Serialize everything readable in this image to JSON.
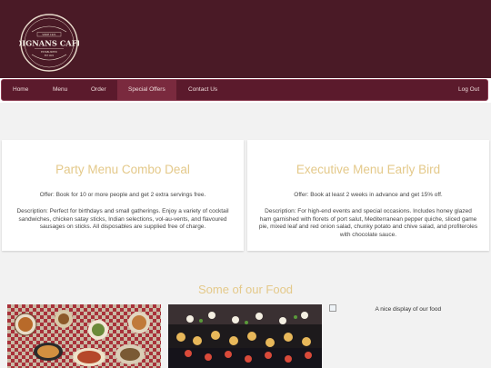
{
  "brand": {
    "name": "DIGNANS CAFE",
    "since": "SINCE 1921",
    "est": "EST 1921",
    "established": "ESTABLISHED"
  },
  "nav": {
    "items": [
      {
        "label": "Home",
        "active": false
      },
      {
        "label": "Menu",
        "active": false
      },
      {
        "label": "Order",
        "active": false
      },
      {
        "label": "Special Offers",
        "active": true
      },
      {
        "label": "Contact Us",
        "active": false
      }
    ],
    "logout": "Log Out"
  },
  "offers": [
    {
      "title": "Party Menu Combo Deal",
      "offer": "Offer: Book for 10 or more people and get 2 extra servings free.",
      "description": "Description: Perfect for birthdays and small gatherings. Enjoy a variety of cocktail sandwiches, chicken satay sticks, Indian selections, vol-au-vents, and flavoured sausages on sticks. All disposables are supplied free of charge."
    },
    {
      "title": "Executive Menu Early Bird",
      "offer": "Offer: Book at least 2 weeks in advance and get 15% off.",
      "description": "Description: For high-end events and special occasions. Includes honey glazed ham garnished with florets of port salut, Mediterranean pepper quiche, sliced game pie, mixed leaf and red onion salad, chunky potato and chive salad, and profiteroles with chocolate sauce."
    }
  ],
  "food": {
    "title": "Some of our Food",
    "broken_image_alt": "A nice display of our food"
  },
  "colors": {
    "header_bg": "#4a1a26",
    "nav_bg": "#5b1a2c",
    "accent_gold": "#e4c98a"
  }
}
